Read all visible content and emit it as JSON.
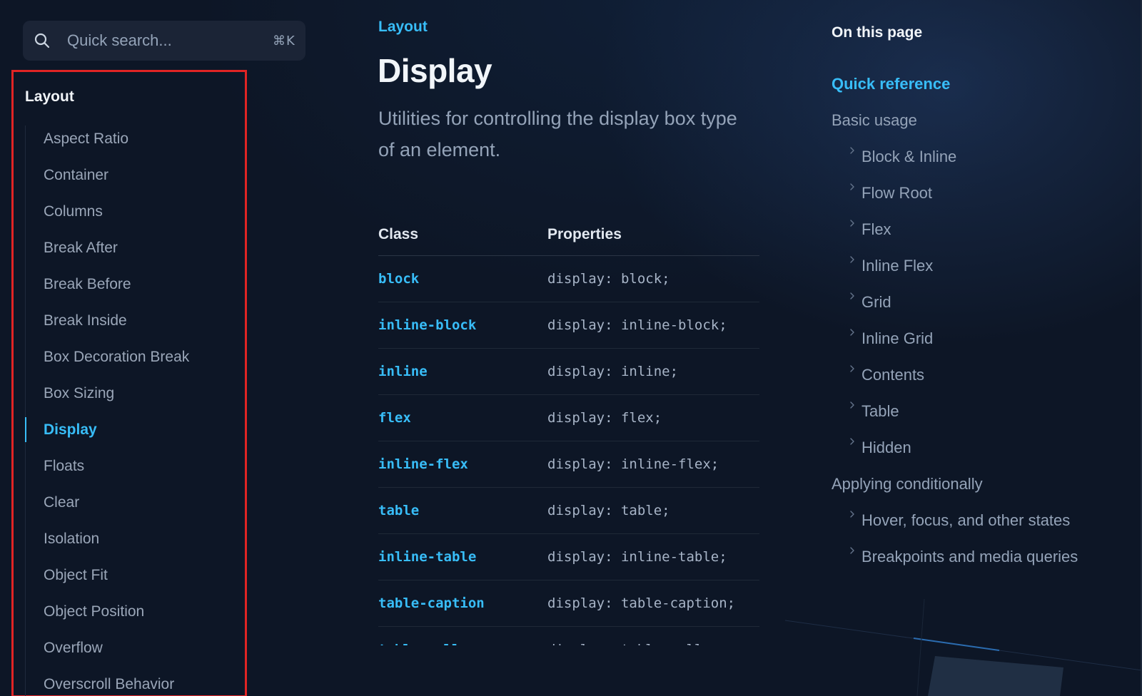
{
  "search": {
    "placeholder": "Quick search...",
    "shortcut": "⌘K"
  },
  "sidebar": {
    "heading": "Layout",
    "items": [
      {
        "label": "Aspect Ratio"
      },
      {
        "label": "Container"
      },
      {
        "label": "Columns"
      },
      {
        "label": "Break After"
      },
      {
        "label": "Break Before"
      },
      {
        "label": "Break Inside"
      },
      {
        "label": "Box Decoration Break"
      },
      {
        "label": "Box Sizing"
      },
      {
        "label": "Display",
        "active": true
      },
      {
        "label": "Floats"
      },
      {
        "label": "Clear"
      },
      {
        "label": "Isolation"
      },
      {
        "label": "Object Fit"
      },
      {
        "label": "Object Position"
      },
      {
        "label": "Overflow"
      },
      {
        "label": "Overscroll Behavior"
      }
    ]
  },
  "main": {
    "eyebrow": "Layout",
    "title": "Display",
    "description": "Utilities for controlling the display box type of an element.",
    "table": {
      "headers": [
        "Class",
        "Properties"
      ],
      "rows": [
        {
          "class": "block",
          "properties": "display: block;"
        },
        {
          "class": "inline-block",
          "properties": "display: inline-block;"
        },
        {
          "class": "inline",
          "properties": "display: inline;"
        },
        {
          "class": "flex",
          "properties": "display: flex;"
        },
        {
          "class": "inline-flex",
          "properties": "display: inline-flex;"
        },
        {
          "class": "table",
          "properties": "display: table;"
        },
        {
          "class": "inline-table",
          "properties": "display: inline-table;"
        },
        {
          "class": "table-caption",
          "properties": "display: table-caption;"
        },
        {
          "class": "table-cell",
          "properties": "display: table-cell;"
        }
      ]
    }
  },
  "toc": {
    "heading": "On this page",
    "items": [
      {
        "label": "Quick reference",
        "level": 1,
        "active": true
      },
      {
        "label": "Basic usage",
        "level": 1
      },
      {
        "label": "Block & Inline",
        "level": 2
      },
      {
        "label": "Flow Root",
        "level": 2
      },
      {
        "label": "Flex",
        "level": 2
      },
      {
        "label": "Inline Flex",
        "level": 2
      },
      {
        "label": "Grid",
        "level": 2
      },
      {
        "label": "Inline Grid",
        "level": 2
      },
      {
        "label": "Contents",
        "level": 2
      },
      {
        "label": "Table",
        "level": 2
      },
      {
        "label": "Hidden",
        "level": 2
      },
      {
        "label": "Applying conditionally",
        "level": 1
      },
      {
        "label": "Hover, focus, and other states",
        "level": 2
      },
      {
        "label": "Breakpoints and media queries",
        "level": 2
      }
    ]
  },
  "colors": {
    "background": "#0d1626",
    "accent": "#38bdf8",
    "highlight_border": "#e02424"
  },
  "icons": {
    "search": "search-icon",
    "toc_chevron": "chevron-right-icon"
  }
}
